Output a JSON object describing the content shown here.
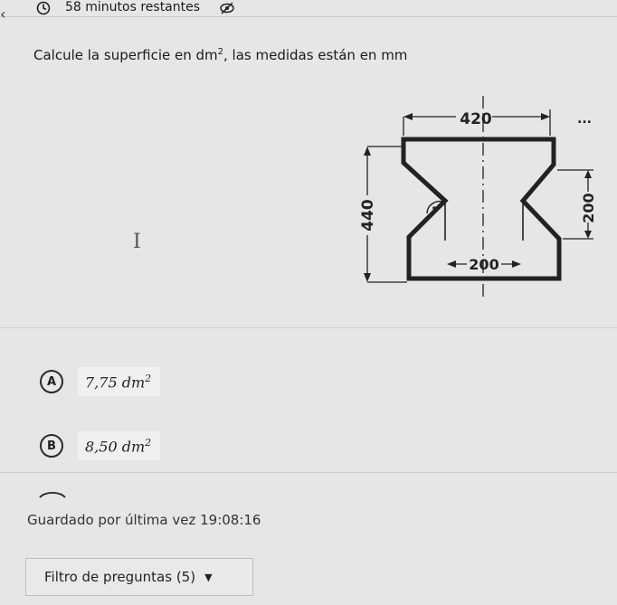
{
  "header": {
    "back_icon": "chevron-left-icon",
    "timer_icon": "timer-icon",
    "timer_text": "58 minutos restantes",
    "visibility_icon": "eye-off-icon"
  },
  "question": {
    "prefix": "Calcule la superficie en dm",
    "exponent": "2",
    "suffix": ", las medidas están en mm"
  },
  "figure": {
    "dim_top": "420",
    "dim_left": "440",
    "dim_right": "200",
    "dim_bottom": "200",
    "ellipsis": "..."
  },
  "options": [
    {
      "letter": "A",
      "value": "7,75 dm",
      "exponent": "2"
    },
    {
      "letter": "B",
      "value": "8,50 dm",
      "exponent": "2"
    }
  ],
  "footer": {
    "saved_label": "Guardado por última vez",
    "saved_time": "19:08:16",
    "filter_label": "Filtro de preguntas (5)"
  }
}
